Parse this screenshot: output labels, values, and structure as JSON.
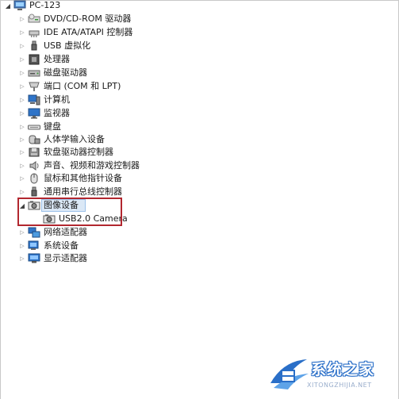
{
  "tree": {
    "root": {
      "label": "PC-123",
      "icon": "computer-icon"
    },
    "items": [
      {
        "label": "DVD/CD-ROM 驱动器",
        "icon": "dvd-drive-icon"
      },
      {
        "label": "IDE ATA/ATAPI 控制器",
        "icon": "ide-controller-icon"
      },
      {
        "label": "USB 虚拟化",
        "icon": "usb-icon"
      },
      {
        "label": "处理器",
        "icon": "processor-icon"
      },
      {
        "label": "磁盘驱动器",
        "icon": "disk-drive-icon"
      },
      {
        "label": "端口 (COM 和 LPT)",
        "icon": "port-icon"
      },
      {
        "label": "计算机",
        "icon": "computer-icon"
      },
      {
        "label": "监视器",
        "icon": "monitor-icon"
      },
      {
        "label": "键盘",
        "icon": "keyboard-icon"
      },
      {
        "label": "人体学输入设备",
        "icon": "hid-icon"
      },
      {
        "label": "软盘驱动器控制器",
        "icon": "floppy-controller-icon"
      },
      {
        "label": "声音、视频和游戏控制器",
        "icon": "sound-icon"
      },
      {
        "label": "鼠标和其他指针设备",
        "icon": "mouse-icon"
      },
      {
        "label": "通用串行总线控制器",
        "icon": "usb-controller-icon"
      },
      {
        "label": "图像设备",
        "icon": "imaging-device-icon",
        "expanded": true,
        "children": [
          {
            "label": "USB2.0 Camera",
            "icon": "camera-icon"
          }
        ]
      },
      {
        "label": "网络适配器",
        "icon": "network-adapter-icon"
      },
      {
        "label": "系统设备",
        "icon": "system-device-icon"
      },
      {
        "label": "显示适配器",
        "icon": "display-adapter-icon"
      }
    ]
  },
  "watermark": {
    "text": "系统之家",
    "url": "XITONGZHIJIA.NET"
  },
  "colors": {
    "highlight_border": "#b2272f",
    "selection": "#dbe8f6",
    "watermark_blue": "#2a6fc8"
  }
}
